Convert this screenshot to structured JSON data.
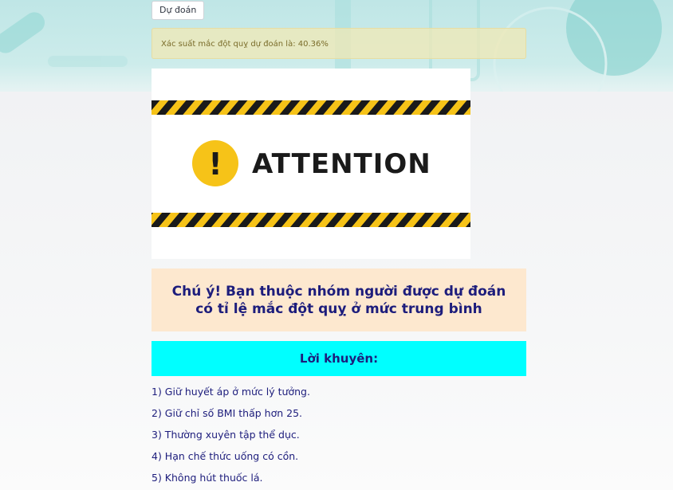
{
  "predict_button": {
    "label": "Dự đoán"
  },
  "result_alert": {
    "text": "Xác suất mắc đột quỵ dự đoán là: 40.36%"
  },
  "attention_image": {
    "text": "ATTENTION",
    "exclamation": "!"
  },
  "warning": {
    "text": "Chú ý! Bạn thuộc nhóm người được dự đoán có tỉ lệ mắc đột quỵ ở mức trung bình"
  },
  "advice": {
    "title": "Lời khuyên:",
    "items": [
      "1) Giữ huyết áp ở mức lý tưởng.",
      "2) Giữ chỉ số BMI thấp hơn 25.",
      "3) Thường xuyên tập thể dục.",
      "4) Hạn chế thức uống có cồn.",
      "5) Không hút thuốc lá."
    ]
  },
  "colors": {
    "advice_header": "#00ffff",
    "warning_bg": "#fde8cf",
    "text_navy": "#1d1d7c",
    "stripe_yellow": "#f6c318",
    "stripe_black": "#1a1a1a"
  }
}
